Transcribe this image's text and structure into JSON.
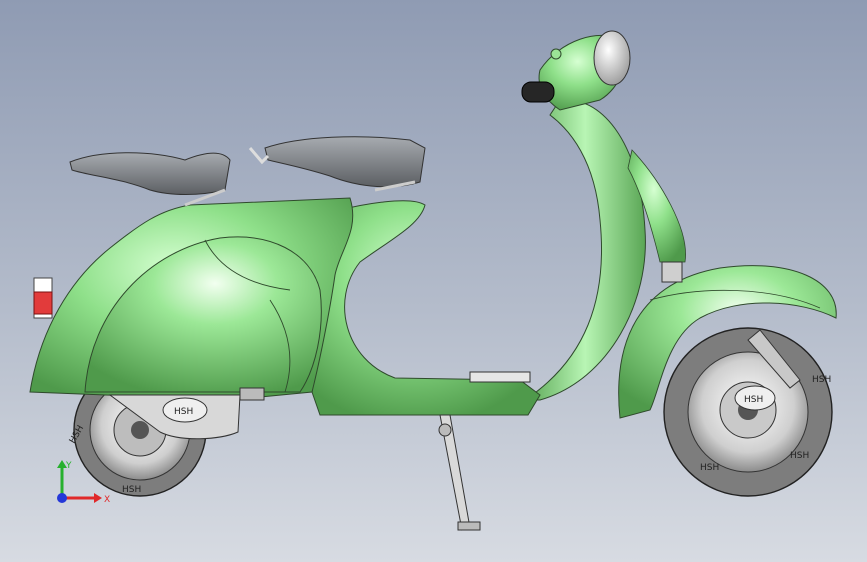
{
  "viewport": {
    "description_name": "3D model viewport",
    "background_top": "#8f9bb3",
    "background_bottom": "#d7dbe2"
  },
  "model": {
    "body_color": "#8fe08a",
    "body_shade": "#5fae5a",
    "edge_color": "#2f4a2c",
    "seat_color": "#7e8185",
    "tire_color": "#8b8b8b",
    "rim_color": "#d9d9d9",
    "tire_brand_text": "HSH",
    "hub_badge_text": "HSH"
  },
  "triad": {
    "x_label": "X",
    "y_label": "Y",
    "x_color": "#e0282a",
    "y_color": "#27b02e",
    "z_color": "#2437d8"
  }
}
